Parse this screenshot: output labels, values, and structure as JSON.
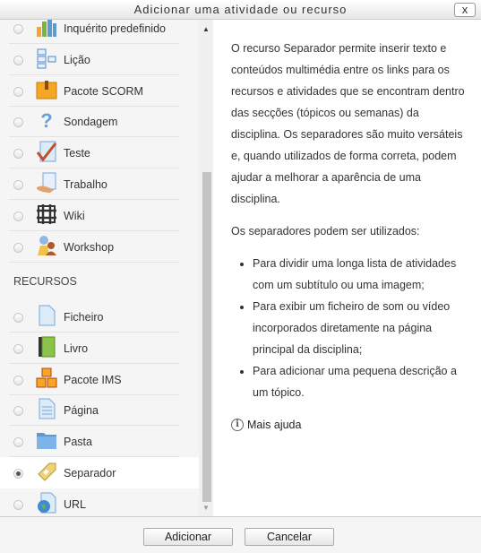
{
  "dialog": {
    "title": "Adicionar uma atividade ou recurso",
    "close_label": "x"
  },
  "activities": [
    {
      "label": "Inquérito predefinido",
      "icon": "survey-chart-icon"
    },
    {
      "label": "Lição",
      "icon": "lesson-icon"
    },
    {
      "label": "Pacote SCORM",
      "icon": "scorm-package-icon"
    },
    {
      "label": "Sondagem",
      "icon": "question-icon"
    },
    {
      "label": "Teste",
      "icon": "quiz-icon"
    },
    {
      "label": "Trabalho",
      "icon": "assignment-icon"
    },
    {
      "label": "Wiki",
      "icon": "wiki-icon"
    },
    {
      "label": "Workshop",
      "icon": "workshop-icon"
    }
  ],
  "resources_heading": "RECURSOS",
  "resources": [
    {
      "label": "Ficheiro",
      "icon": "file-icon"
    },
    {
      "label": "Livro",
      "icon": "book-icon"
    },
    {
      "label": "Pacote IMS",
      "icon": "ims-package-icon"
    },
    {
      "label": "Página",
      "icon": "page-icon"
    },
    {
      "label": "Pasta",
      "icon": "folder-icon"
    },
    {
      "label": "Separador",
      "icon": "label-tag-icon",
      "selected": true
    },
    {
      "label": "URL",
      "icon": "url-icon"
    }
  ],
  "description": {
    "p1": "O recurso Separador permite inserir texto e conteúdos multimédia entre os links para os recursos e atividades que se encontram dentro das secções (tópicos ou semanas) da disciplina. Os separadores são muito versáteis e, quando utilizados de forma correta, podem ajudar a melhorar a aparência de uma disciplina.",
    "p2": "Os separadores podem ser utilizados:",
    "bullets": [
      "Para dividir uma longa lista de atividades com um subtítulo ou uma imagem;",
      "Para exibir um ficheiro de som ou vídeo incorporados diretamente na página principal da disciplina;",
      "Para adicionar uma pequena descrição a um tópico."
    ],
    "help_link": "Mais ajuda"
  },
  "footer": {
    "add_label": "Adicionar",
    "cancel_label": "Cancelar"
  }
}
